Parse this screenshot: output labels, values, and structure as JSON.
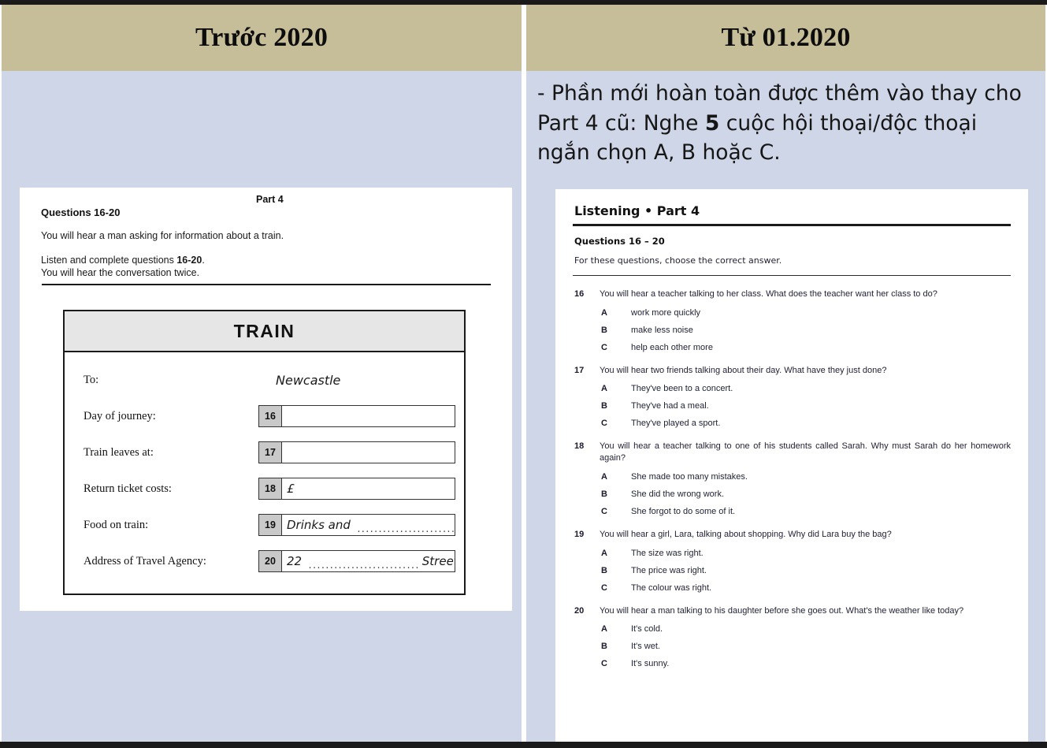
{
  "headers": {
    "left": "Trước 2020",
    "right": "Từ 01.2020"
  },
  "right_column": {
    "note_part1": "- Phần mới hoàn toàn được thêm vào thay cho Part 4 cũ: Nghe ",
    "note_bold": "5",
    "note_part2": " cuộc hội thoại/độc thoại ngắn chọn A, B hoặc C."
  },
  "left_paper": {
    "part_title": "Part 4",
    "questions_heading": "Questions 16-20",
    "intro_line": "You will hear a man asking for information about a train.",
    "listen_line_prefix": "Listen and complete questions ",
    "listen_line_bold": "16-20",
    "listen_line_suffix": ".",
    "twice_line": "You will hear the conversation twice.",
    "form": {
      "title": "TRAIN",
      "rows": [
        {
          "label": "To:",
          "kind": "static",
          "value": "Newcastle"
        },
        {
          "label": "Day of journey:",
          "kind": "answer",
          "number": "16",
          "value": ""
        },
        {
          "label": "Train leaves at:",
          "kind": "answer",
          "number": "17",
          "value": ""
        },
        {
          "label": "Return ticket costs:",
          "kind": "answer",
          "number": "18",
          "value": "£"
        },
        {
          "label": "Food on train:",
          "kind": "answer",
          "number": "19",
          "value": "Drinks and",
          "trailing_dots": true
        },
        {
          "label": "Address of Travel Agency:",
          "kind": "answer",
          "number": "20",
          "value": "22",
          "middle_dots": true,
          "value_after": "Street"
        }
      ]
    }
  },
  "right_paper": {
    "title": "Listening • Part 4",
    "questions_heading": "Questions 16 – 20",
    "instruction": "For these questions, choose the correct answer.",
    "questions": [
      {
        "number": "16",
        "text": "You will hear a teacher talking to her class. What does the teacher want her class to do?",
        "justify": false,
        "options": [
          {
            "letter": "A",
            "text": "work more quickly"
          },
          {
            "letter": "B",
            "text": "make less noise"
          },
          {
            "letter": "C",
            "text": "help each other more"
          }
        ]
      },
      {
        "number": "17",
        "text": "You will hear two friends talking about their day. What have they just done?",
        "justify": false,
        "options": [
          {
            "letter": "A",
            "text": "They've been to a concert."
          },
          {
            "letter": "B",
            "text": "They've had a meal."
          },
          {
            "letter": "C",
            "text": "They've played a sport."
          }
        ]
      },
      {
        "number": "18",
        "text": "You will hear a teacher talking to one of his students called Sarah. Why must Sarah do her homework again?",
        "justify": true,
        "options": [
          {
            "letter": "A",
            "text": "She made too many mistakes."
          },
          {
            "letter": "B",
            "text": "She did the wrong work."
          },
          {
            "letter": "C",
            "text": "She forgot to do some of it."
          }
        ]
      },
      {
        "number": "19",
        "text": "You will hear a girl, Lara, talking about shopping. Why did Lara buy the bag?",
        "justify": false,
        "options": [
          {
            "letter": "A",
            "text": "The size was right."
          },
          {
            "letter": "B",
            "text": "The price was right."
          },
          {
            "letter": "C",
            "text": "The colour was right."
          }
        ]
      },
      {
        "number": "20",
        "text": "You will hear a man talking to his daughter before she goes out. What's the weather like today?",
        "justify": false,
        "options": [
          {
            "letter": "A",
            "text": "It's cold."
          },
          {
            "letter": "B",
            "text": "It's wet."
          },
          {
            "letter": "C",
            "text": "It's sunny."
          }
        ]
      }
    ]
  },
  "colors": {
    "header_band": "#c6bd99",
    "body_background": "#ced6e7",
    "paper": "#ffffff",
    "rule": "#1a1a1a",
    "form_number_cell": "#c9c9c9",
    "form_title_cell": "#e6e6e6"
  }
}
